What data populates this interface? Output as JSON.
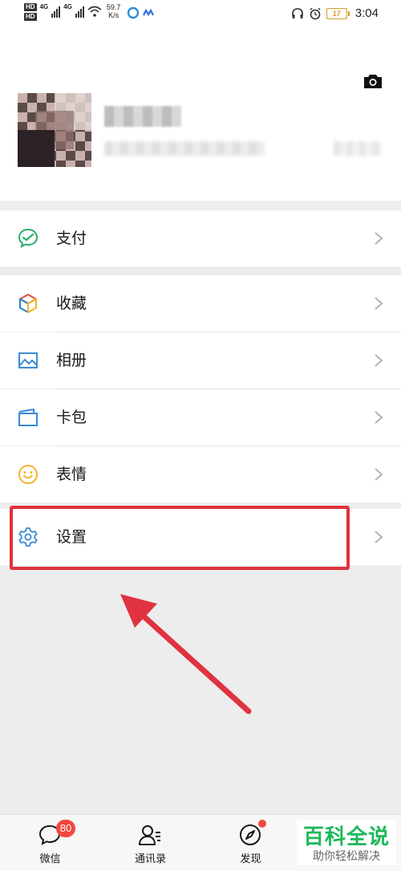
{
  "status_bar": {
    "hd_top": "HD",
    "hd_bottom": "HD",
    "net1": "4G",
    "net2": "4G",
    "speed_value": "59.7",
    "speed_unit": "K/s",
    "battery": "17",
    "time": "3:04"
  },
  "menu": {
    "pay": "支付",
    "favorites": "收藏",
    "album": "相册",
    "cards": "卡包",
    "stickers": "表情",
    "settings": "设置"
  },
  "tabbar": {
    "chats": "微信",
    "chats_badge": "80",
    "contacts": "通讯录",
    "discover": "发现"
  },
  "watermark": {
    "title": "百科全说",
    "subtitle": "助你轻松解决"
  },
  "colors": {
    "highlight": "#e0323f",
    "badge": "#f1473f",
    "pay_icon": "#2aae67",
    "watermark": "#1eb85a"
  }
}
